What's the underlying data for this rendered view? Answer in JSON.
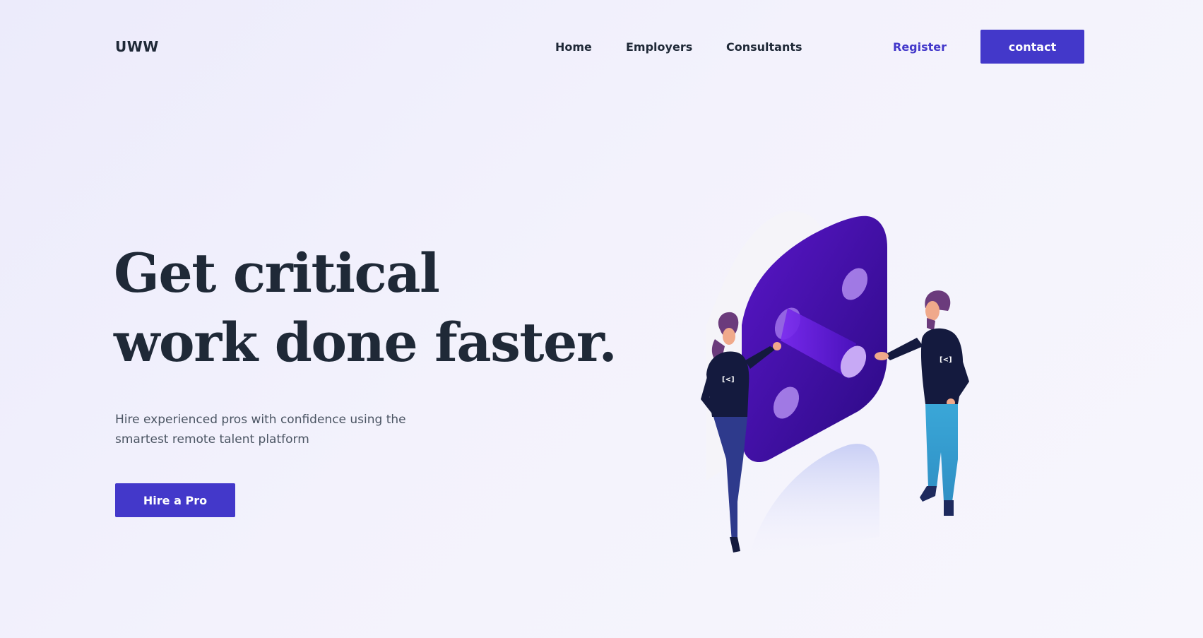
{
  "header": {
    "logo": "UWW",
    "nav": {
      "home": "Home",
      "employers": "Employers",
      "consultants": "Consultants"
    },
    "register_label": "Register",
    "contact_label": "contact"
  },
  "hero": {
    "headline_line1": "Get critical",
    "headline_line2": "work done faster.",
    "subtext": "Hire experienced pros with confidence using the smartest remote talent platform",
    "cta_label": "Hire a Pro"
  },
  "colors": {
    "accent": "#4338ca",
    "text_dark": "#1f2937",
    "text_muted": "#4b5563",
    "illustration_purple": "#4c0fb8"
  },
  "icons": {
    "illustration": "team-collaboration-illustration"
  }
}
